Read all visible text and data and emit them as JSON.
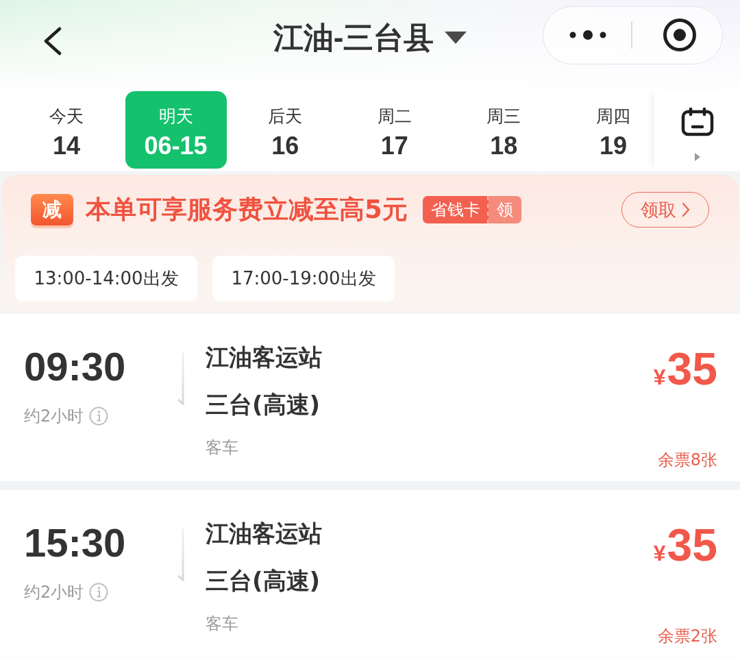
{
  "header": {
    "title": "江油-三台县"
  },
  "date_tabs": [
    {
      "label": "今天",
      "date": "14",
      "selected": false
    },
    {
      "label": "明天",
      "date": "06-15",
      "selected": true
    },
    {
      "label": "后天",
      "date": "16",
      "selected": false
    },
    {
      "label": "周二",
      "date": "17",
      "selected": false
    },
    {
      "label": "周三",
      "date": "18",
      "selected": false
    },
    {
      "label": "周四",
      "date": "19",
      "selected": false
    }
  ],
  "promo": {
    "badge": "减",
    "text": "本单可享服务费立减至高5元",
    "card_name": "省钱卡",
    "card_action": "领",
    "button": "领取"
  },
  "time_filters": [
    {
      "label": "13:00-14:00出发",
      "selected": false
    },
    {
      "label": "17:00-19:00出发",
      "selected": false
    }
  ],
  "trips": [
    {
      "time": "09:30",
      "duration": "约2小时",
      "from": "江油客运站",
      "to": "三台(高速)",
      "vehicle": "客车",
      "currency": "¥",
      "price": "35",
      "tickets_left": "余票8张"
    },
    {
      "time": "15:30",
      "duration": "约2小时",
      "from": "江油客运站",
      "to": "三台(高速)",
      "vehicle": "客车",
      "currency": "¥",
      "price": "35",
      "tickets_left": "余票2张"
    }
  ]
}
